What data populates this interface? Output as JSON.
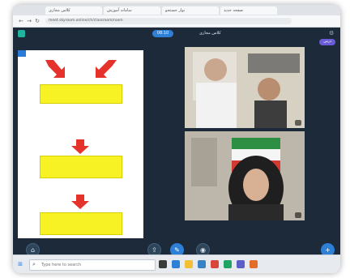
{
  "browser": {
    "tabs": [
      "کلاس مجازی",
      "سامانه آموزش",
      "نوار جستجو",
      "صفحه جدید"
    ],
    "url": "meet.skyroom.online/ch/classroom/room"
  },
  "meeting": {
    "pill_label": "08:10",
    "title": "کلاس مجازی",
    "record_badge": "درس",
    "participants": [
      {
        "name": ""
      },
      {
        "name": ""
      }
    ]
  },
  "slide": {
    "boxes": [
      {
        "line1": "",
        "line2": ""
      },
      {
        "line1": "",
        "line2": ""
      },
      {
        "line1": "",
        "line2": ""
      }
    ],
    "accent_red": "#e5322b",
    "box_yellow": "#f7f224"
  },
  "controls": {
    "icons": [
      "home-icon",
      "share-icon",
      "pen-icon",
      "camera-icon",
      "plus-icon"
    ]
  },
  "taskbar": {
    "search_placeholder": "Type here to search",
    "clock": ""
  }
}
